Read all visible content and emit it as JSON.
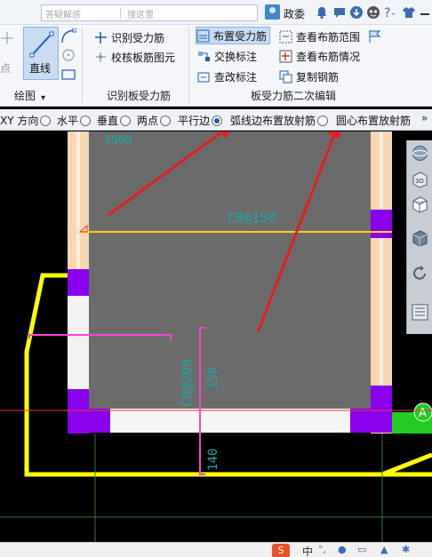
{
  "topbar": {
    "search_hint": "答疑解惑",
    "search_placeholder": "搜这里",
    "user_name": "政委",
    "icons": [
      "user-icon",
      "bell-icon",
      "chat-icon",
      "download-icon",
      "mascot-icon",
      "help-icon",
      "shirt-icon"
    ]
  },
  "ribbon": {
    "left_partial_label": "点",
    "draw_group": {
      "line_label": "直线",
      "group_label": "绘图",
      "dropdown": "▾"
    },
    "recognize_group": {
      "items": [
        "识别受力筋",
        "校核板筋图元"
      ],
      "group_label": "识别板受力筋"
    },
    "edit_group": {
      "col1": [
        "布置受力筋",
        "交换标注",
        "查改标注"
      ],
      "col2": [
        "查看布筋范围",
        "查看布筋情况",
        "复制钢筋"
      ],
      "group_label": "板受力筋二次编辑"
    }
  },
  "options": {
    "items": [
      {
        "label": "XY 方向",
        "selected": false
      },
      {
        "label": "水平",
        "selected": false
      },
      {
        "label": "垂直",
        "selected": false
      },
      {
        "label": "两点",
        "selected": false
      },
      {
        "label": "平行边",
        "selected": true
      },
      {
        "label": "弧线边布置放射筋",
        "selected": false
      },
      {
        "label": "圆心布置放射筋",
        "selected": false
      }
    ],
    "more": "»"
  },
  "canvas": {
    "top_rebar_label": "C8@150",
    "vertical_rebar_label": "C8@200",
    "dim_top": "1900",
    "dim_right_1": "150",
    "dim_right_2": "140",
    "marker_letter": "A",
    "colors": {
      "slab": "#6b6b6b",
      "beam": "#f9d7b0",
      "support": "#8800ee",
      "rebar_line": "#ffd400",
      "outline": "#ffff00",
      "annotation": "#ff44cc",
      "arrow": "#e81d1d",
      "accent_green": "#22cc22"
    }
  },
  "viewbar": {
    "icons": [
      "globe-icon",
      "view-3d-icon",
      "cube-wire-icon",
      "cube-solid-icon",
      "rotate-icon",
      "layers-panel-icon"
    ]
  },
  "taskbar": {
    "ime_label": "S",
    "ime_lang": "中",
    "symbols": [
      "°,",
      "🎤",
      "⌨",
      "👕",
      "⚙"
    ]
  }
}
